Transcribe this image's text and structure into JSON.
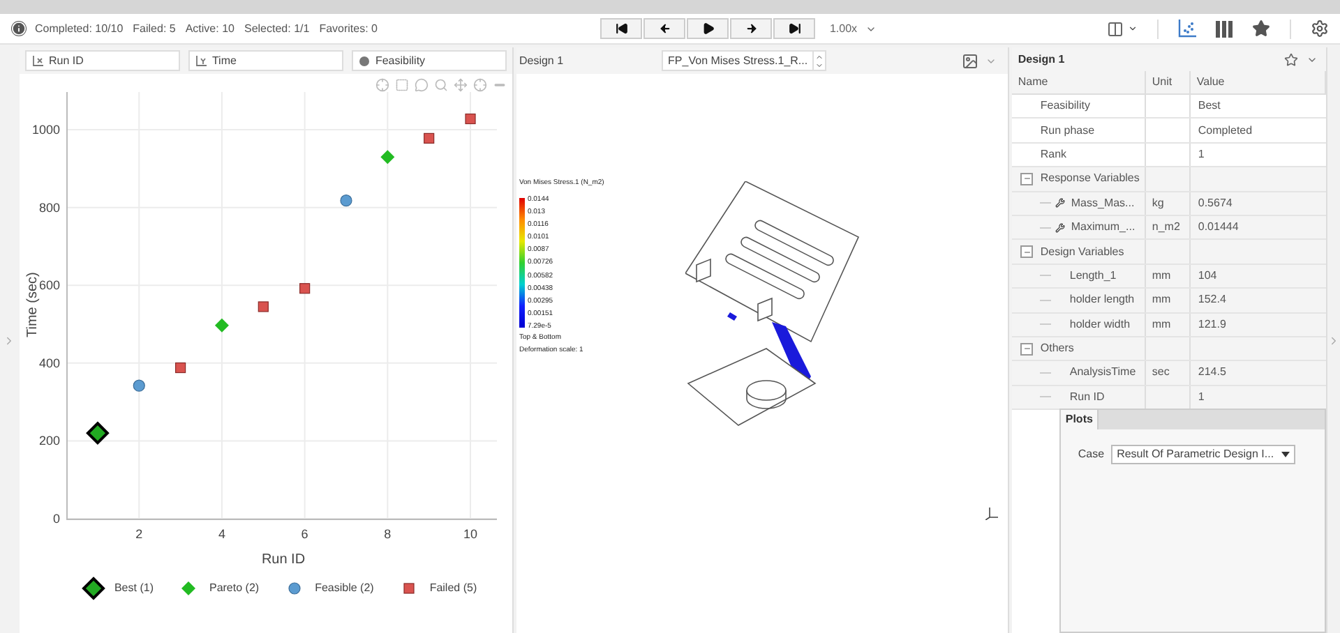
{
  "status": {
    "items": [
      "Completed: 10/10",
      "Failed: 5",
      "Active: 10",
      "Selected: 1/1",
      "Favorites: 0"
    ]
  },
  "playback": {
    "speed": "1.00x"
  },
  "plot_panel": {
    "fields": [
      {
        "kind": "x",
        "value": "Run ID"
      },
      {
        "kind": "y",
        "value": "Time"
      },
      {
        "kind": "color",
        "value": "Feasibility"
      }
    ],
    "chart_data": {
      "type": "scatter",
      "xlabel": "Run ID",
      "ylabel": "Time (sec)",
      "x": [
        1,
        2,
        3,
        4,
        5,
        6,
        7,
        8,
        9,
        10
      ],
      "xticks": [
        2,
        4,
        6,
        8,
        10
      ],
      "yticks": [
        0,
        200,
        400,
        600,
        800,
        1000
      ],
      "xlim": [
        0.26,
        10.64
      ],
      "ylim": [
        0,
        1097
      ],
      "grid": true,
      "series": [
        {
          "name": "Best (1)",
          "color": "#22aa22",
          "values": [
            220,
            null,
            null,
            null,
            null,
            null,
            null,
            null,
            null,
            null
          ]
        },
        {
          "name": "Pareto (2)",
          "color": "#22bb22",
          "values": [
            null,
            null,
            null,
            497,
            null,
            null,
            null,
            930,
            null,
            null
          ]
        },
        {
          "name": "Feasible (2)",
          "color": "#5b9bd0",
          "values": [
            null,
            342,
            null,
            null,
            null,
            null,
            818,
            null,
            null,
            null
          ]
        },
        {
          "name": "Failed (5)",
          "color": "#d9534f",
          "values": [
            null,
            null,
            388,
            null,
            545,
            592,
            null,
            null,
            978,
            1028
          ]
        }
      ]
    }
  },
  "view_panel": {
    "title": "Design 1",
    "result": "FP_Von Mises Stress.1_R...",
    "legend": {
      "title": "Von Mises Stress.1 (N_m2)",
      "values": [
        "0.0144",
        "0.013",
        "0.0116",
        "0.0101",
        "0.0087",
        "0.00726",
        "0.00582",
        "0.00438",
        "0.00295",
        "0.00151",
        "7.29e-5"
      ],
      "notes": [
        "Top & Bottom",
        "Deformation scale: 1"
      ]
    }
  },
  "details": {
    "title": "Design 1",
    "favorite": false,
    "columns": [
      "Name",
      "Unit",
      "Value"
    ],
    "rows": [
      {
        "kind": "row",
        "name": "Feasibility",
        "value": "Best"
      },
      {
        "kind": "row",
        "name": "Run phase",
        "value": "Completed"
      },
      {
        "kind": "row",
        "name": "Rank",
        "value": "1"
      },
      {
        "kind": "group",
        "name": "Response Variables",
        "expanded": true,
        "children": [
          {
            "kind": "output",
            "name": "Mass_Mas...",
            "unit": "kg",
            "value": "0.5674"
          },
          {
            "kind": "output",
            "name": "Maximum_...",
            "unit": "n_m2",
            "value": "0.01444"
          }
        ]
      },
      {
        "kind": "group",
        "name": "Design Variables",
        "expanded": true,
        "children": [
          {
            "kind": "input",
            "name": "Length_1",
            "unit": "mm",
            "value": "104"
          },
          {
            "kind": "input",
            "name": "holder length",
            "unit": "mm",
            "value": "152.4"
          },
          {
            "kind": "input",
            "name": "holder width",
            "unit": "mm",
            "value": "121.9"
          }
        ]
      },
      {
        "kind": "group",
        "name": "Others",
        "expanded": true,
        "children": [
          {
            "kind": "input",
            "name": "AnalysisTime",
            "unit": "sec",
            "value": "214.5"
          },
          {
            "kind": "input",
            "name": "Run ID",
            "value": "1"
          }
        ]
      }
    ]
  },
  "plots_popup": {
    "tab": "Plots",
    "label": "Case",
    "value": "Result Of Parametric Design I..."
  }
}
